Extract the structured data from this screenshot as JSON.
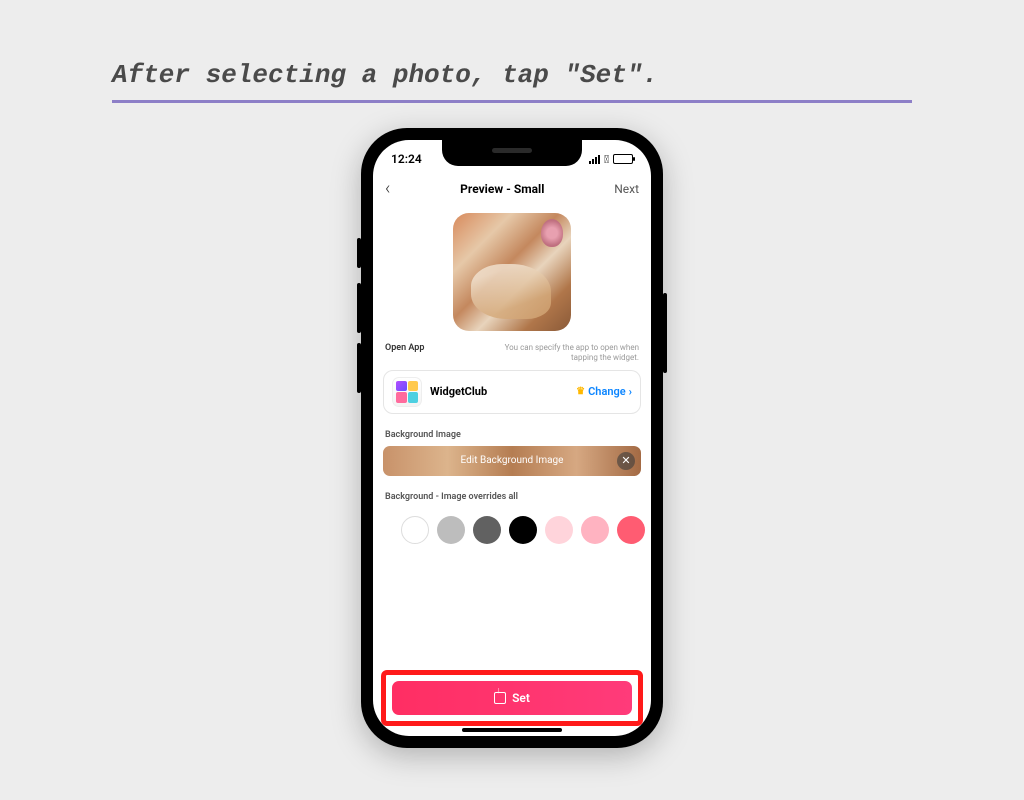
{
  "instruction": "After selecting a photo, tap \"Set\".",
  "status": {
    "time": "12:24"
  },
  "nav": {
    "title": "Preview - Small",
    "next": "Next"
  },
  "openApp": {
    "label": "Open App",
    "hint": "You can specify the app to open when tapping the widget.",
    "appName": "WidgetClub",
    "change": "Change"
  },
  "bg": {
    "label": "Background Image",
    "editLabel": "Edit Background Image",
    "overrideLabel": "Background - Image overrides all"
  },
  "setBtn": "Set",
  "swatches": [
    "#ffffff",
    "#bdbdbd",
    "#616161",
    "#000000",
    "#ffd4db",
    "#ffb3c1",
    "#ff5c72"
  ]
}
